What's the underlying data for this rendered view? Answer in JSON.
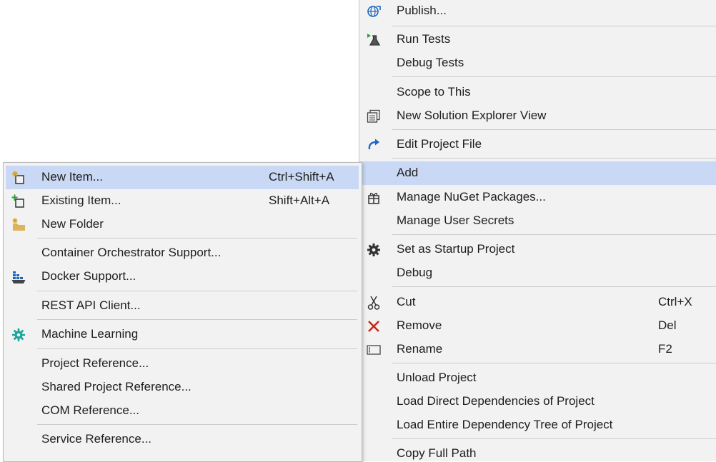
{
  "main_menu": {
    "items": [
      {
        "id": "publish",
        "label": "Publish...",
        "icon": "globe-publish-icon"
      },
      {
        "id": "run_tests",
        "label": "Run Tests",
        "icon": "run-tests-flask-icon"
      },
      {
        "id": "debug_tests",
        "label": "Debug Tests"
      },
      {
        "id": "scope_to_this",
        "label": "Scope to This"
      },
      {
        "id": "new_solution_explorer_view",
        "label": "New Solution Explorer View",
        "icon": "solution-explorer-view-icon"
      },
      {
        "id": "edit_project_file",
        "label": "Edit Project File",
        "icon": "edit-redo-arrow-icon"
      },
      {
        "id": "add",
        "label": "Add"
      },
      {
        "id": "manage_nuget",
        "label": "Manage NuGet Packages...",
        "icon": "nuget-package-icon"
      },
      {
        "id": "manage_user_secrets",
        "label": "Manage User Secrets"
      },
      {
        "id": "set_startup",
        "label": "Set as Startup Project",
        "icon": "gear-icon"
      },
      {
        "id": "debug",
        "label": "Debug"
      },
      {
        "id": "cut",
        "label": "Cut",
        "shortcut": "Ctrl+X",
        "icon": "scissors-icon"
      },
      {
        "id": "remove",
        "label": "Remove",
        "shortcut": "Del",
        "icon": "red-x-icon"
      },
      {
        "id": "rename",
        "label": "Rename",
        "shortcut": "F2",
        "icon": "rename-icon"
      },
      {
        "id": "unload_project",
        "label": "Unload Project"
      },
      {
        "id": "load_direct",
        "label": "Load Direct Dependencies of Project"
      },
      {
        "id": "load_entire",
        "label": "Load Entire Dependency Tree of Project"
      },
      {
        "id": "copy_full_path",
        "label": "Copy Full Path"
      }
    ]
  },
  "add_submenu": {
    "items": [
      {
        "id": "new_item",
        "label": "New Item...",
        "shortcut": "Ctrl+Shift+A",
        "icon": "new-item-icon"
      },
      {
        "id": "existing_item",
        "label": "Existing Item...",
        "shortcut": "Shift+Alt+A",
        "icon": "existing-item-icon"
      },
      {
        "id": "new_folder",
        "label": "New Folder",
        "icon": "new-folder-icon"
      },
      {
        "id": "container_orchestrator",
        "label": "Container Orchestrator Support..."
      },
      {
        "id": "docker_support",
        "label": "Docker Support...",
        "icon": "docker-whale-icon"
      },
      {
        "id": "rest_api_client",
        "label": "REST API Client..."
      },
      {
        "id": "machine_learning",
        "label": "Machine Learning",
        "icon": "machine-learning-gear-icon"
      },
      {
        "id": "project_reference",
        "label": "Project Reference..."
      },
      {
        "id": "shared_project_reference",
        "label": "Shared Project Reference..."
      },
      {
        "id": "com_reference",
        "label": "COM Reference..."
      },
      {
        "id": "service_reference",
        "label": "Service Reference..."
      }
    ]
  },
  "colors": {
    "menu_background": "#f2f2f2",
    "highlight": "#c9d8f5",
    "separator": "#cccccc",
    "text": "#1e1e1e",
    "accent_blue": "#1c66c2",
    "remove_red": "#c42b1c",
    "ml_teal": "#1ba39c"
  }
}
